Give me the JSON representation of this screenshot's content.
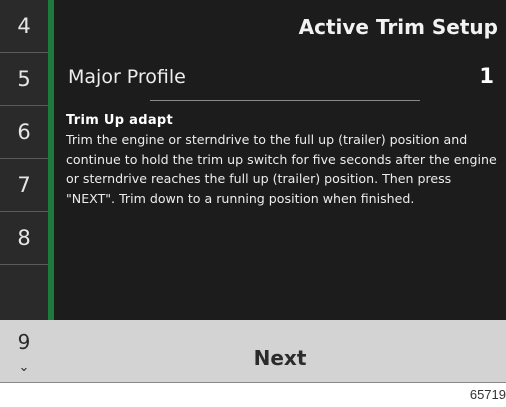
{
  "header": {
    "title": "Active Trim Setup"
  },
  "side_menu": {
    "up_icon": "chevron-up-icon",
    "items": [
      "4",
      "5",
      "6",
      "7",
      "8"
    ],
    "current": "9",
    "down_icon": "chevron-down-icon"
  },
  "profile": {
    "label": "Major Profile",
    "value": "1"
  },
  "content": {
    "heading": "Trim Up adapt",
    "body": "Trim the engine or sterndrive to the full up (trailer) position and continue to hold the trim up switch for five seconds after the engine or sterndrive reaches the full up (trailer) position. Then press \"NEXT\". Trim down to a running position when finished."
  },
  "footer": {
    "next_label": "Next"
  },
  "figure_id": "65719",
  "colors": {
    "accent": "#1e7a3c",
    "panel": "#1c1c1c",
    "side": "#2a2a2a",
    "footer": "#d3d3d3"
  }
}
